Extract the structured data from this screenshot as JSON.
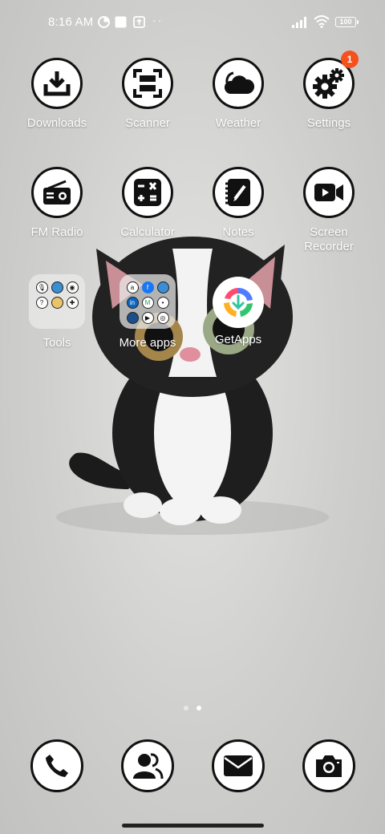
{
  "status_bar": {
    "time": "8:16 AM",
    "battery": "100",
    "more_indicator": "··"
  },
  "apps": {
    "downloads": "Downloads",
    "scanner": "Scanner",
    "weather": "Weather",
    "settings": "Settings",
    "settings_badge": "1",
    "fm_radio": "FM Radio",
    "calculator": "Calculator",
    "notes": "Notes",
    "screen_recorder": "Screen Recorder",
    "tools": "Tools",
    "more_apps": "More apps",
    "getapps": "GetApps"
  },
  "pages": {
    "count": 2,
    "current": 2
  },
  "dock": [
    "phone-icon",
    "contacts-icon",
    "messages-icon",
    "camera-icon"
  ],
  "colors": {
    "badge": "#f4511e",
    "icon_border": "#111111"
  }
}
